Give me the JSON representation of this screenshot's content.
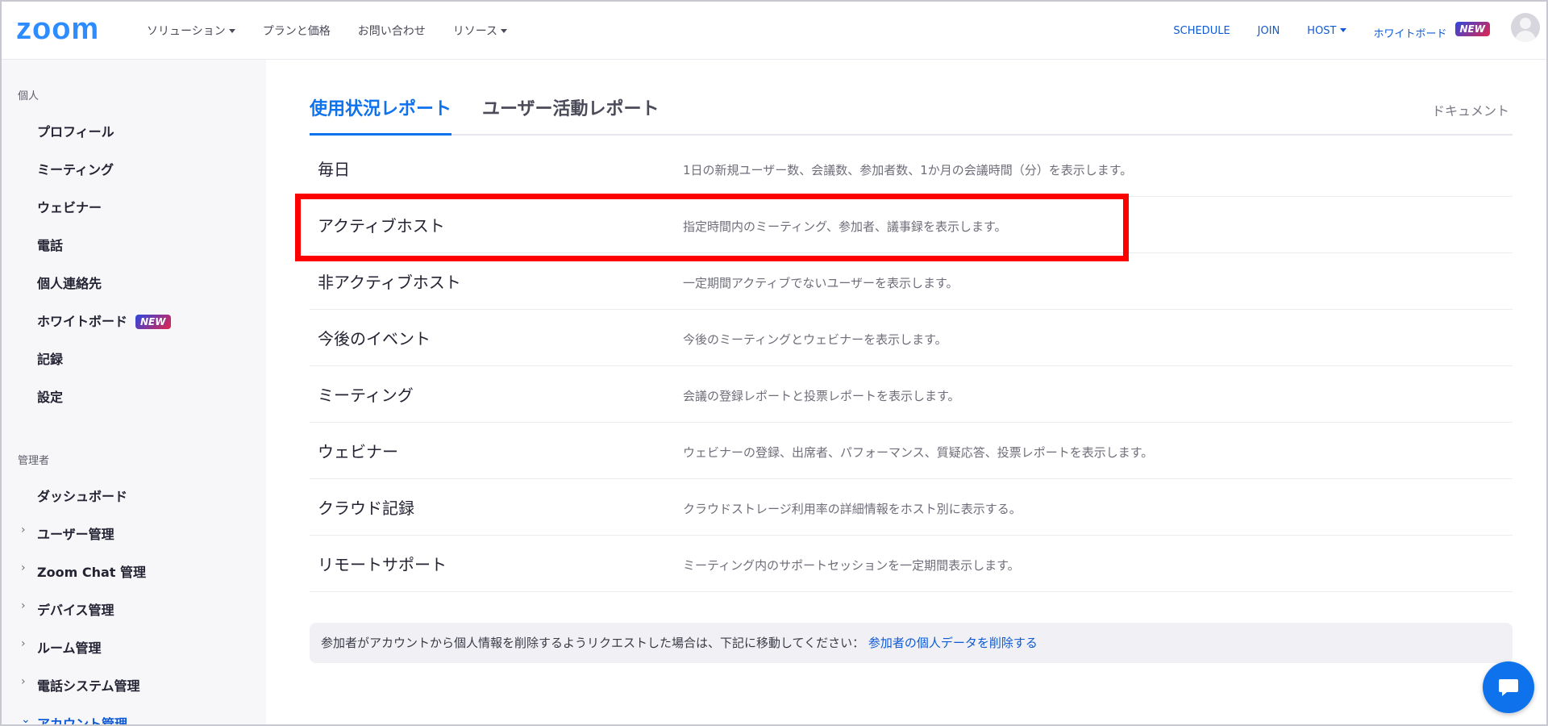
{
  "header": {
    "logo": "zoom",
    "nav": [
      {
        "label": "ソリューション",
        "dropdown": true
      },
      {
        "label": "プランと価格",
        "dropdown": false
      },
      {
        "label": "お問い合わせ",
        "dropdown": false
      },
      {
        "label": "リソース",
        "dropdown": true
      }
    ],
    "right": {
      "schedule": "SCHEDULE",
      "join": "JOIN",
      "host": "HOST",
      "whiteboard": "ホワイトボード",
      "whiteboard_badge": "NEW"
    }
  },
  "sidebar": {
    "personal_heading": "個人",
    "personal_items": [
      {
        "label": "プロフィール"
      },
      {
        "label": "ミーティング"
      },
      {
        "label": "ウェビナー"
      },
      {
        "label": "電話"
      },
      {
        "label": "個人連絡先"
      },
      {
        "label": "ホワイトボード",
        "badge": "NEW"
      },
      {
        "label": "記録"
      },
      {
        "label": "設定"
      }
    ],
    "admin_heading": "管理者",
    "admin_items": [
      {
        "label": "ダッシュボード"
      },
      {
        "label": "ユーザー管理"
      },
      {
        "label": "Zoom Chat 管理"
      },
      {
        "label": "デバイス管理"
      },
      {
        "label": "ルーム管理"
      },
      {
        "label": "電話システム管理"
      },
      {
        "label": "アカウント管理"
      }
    ]
  },
  "main": {
    "tabs": [
      {
        "label": "使用状況レポート",
        "active": true
      },
      {
        "label": "ユーザー活動レポート",
        "active": false
      }
    ],
    "doc_link": "ドキュメント",
    "reports": [
      {
        "title": "毎日",
        "desc": "1日の新規ユーザー数、会議数、参加者数、1か月の会議時間（分）を表示します。"
      },
      {
        "title": "アクティブホスト",
        "desc": "指定時間内のミーティング、参加者、議事録を表示します。"
      },
      {
        "title": "非アクティブホスト",
        "desc": "一定期間アクティブでないユーザーを表示します。"
      },
      {
        "title": "今後のイベント",
        "desc": "今後のミーティングとウェビナーを表示します。"
      },
      {
        "title": "ミーティング",
        "desc": "会議の登録レポートと投票レポートを表示します。"
      },
      {
        "title": "ウェビナー",
        "desc": "ウェビナーの登録、出席者、パフォーマンス、質疑応答、投票レポートを表示します。"
      },
      {
        "title": "クラウド記録",
        "desc": "クラウドストレージ利用率の詳細情報をホスト別に表示する。"
      },
      {
        "title": "リモートサポート",
        "desc": "ミーティング内のサポートセッションを一定期間表示します。"
      }
    ],
    "notice_text": "参加者がアカウントから個人情報を削除するようリクエストした場合は、下記に移動してください：",
    "notice_link": "参加者の個人データを削除する"
  },
  "colors": {
    "brand": "#2d8cff",
    "link": "#0e5ad6",
    "highlight": "#ff0000"
  },
  "icons": {
    "chat": "chat-bubble-icon",
    "avatar": "user-avatar-icon"
  }
}
